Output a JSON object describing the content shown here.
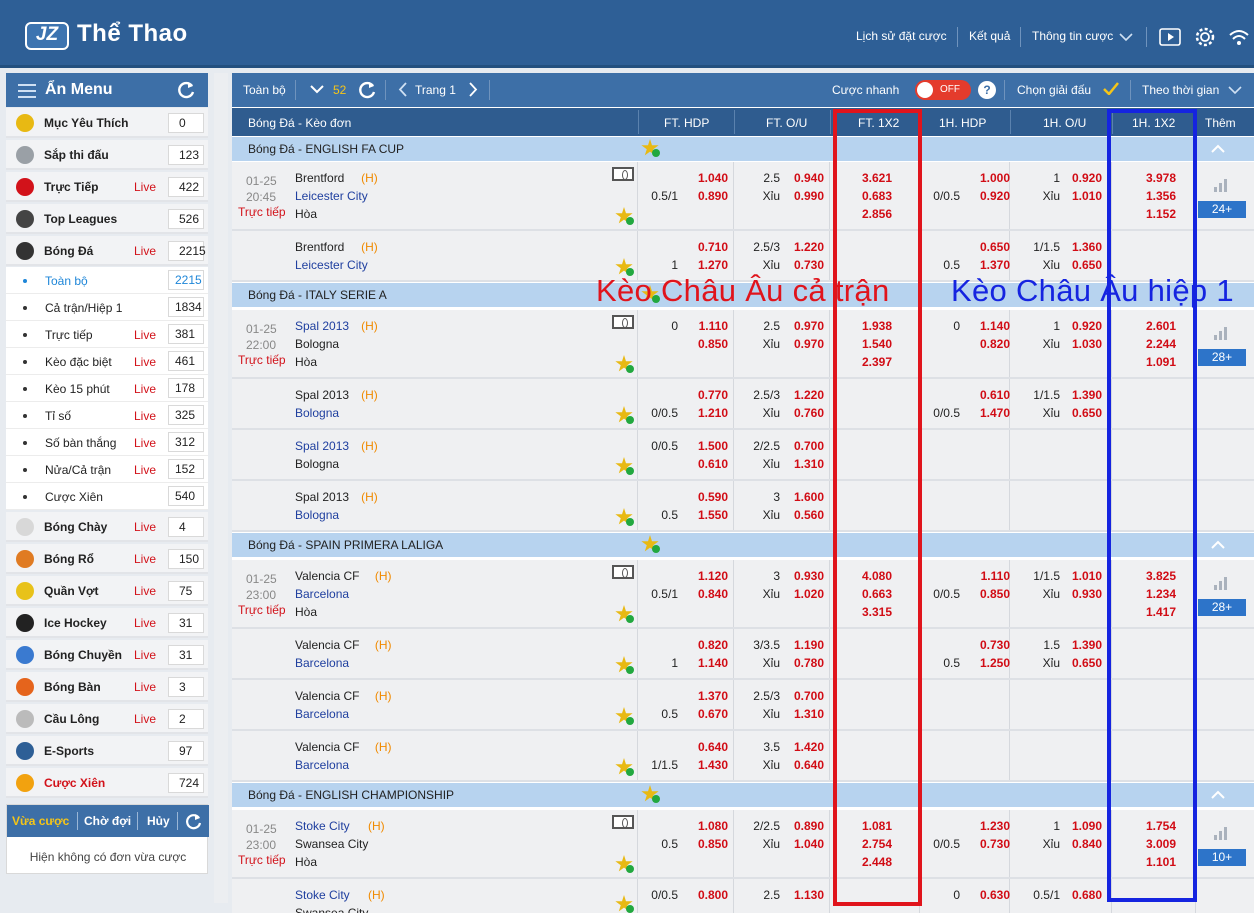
{
  "header": {
    "logo_mark": "JZ",
    "title": "Thể Thao",
    "nav": [
      "Lịch sử đặt cược",
      "Kết quả",
      "Thông tin cược"
    ]
  },
  "sidebar": {
    "title": "Ẩn Menu",
    "items": [
      {
        "label": "Mục Yêu Thích",
        "live": "",
        "count": "0",
        "icon": "star-icon",
        "color": "#e8b913"
      },
      {
        "label": "Sắp thi đấu",
        "live": "",
        "count": "123",
        "icon": "stopwatch-icon",
        "color": "#9aa0a6"
      },
      {
        "label": "Trực Tiếp",
        "live": "Live",
        "count": "422",
        "icon": "live-play-icon",
        "color": "#d2121a"
      },
      {
        "label": "Top Leagues",
        "live": "",
        "count": "526",
        "icon": "soccer-ball-icon",
        "color": "#444"
      },
      {
        "label": "Bóng Đá",
        "live": "Live",
        "count": "2215",
        "icon": "soccer-ball-icon",
        "color": "#333"
      }
    ],
    "subitems": [
      {
        "label": "Toàn bộ",
        "live": "",
        "count": "2215",
        "active": true
      },
      {
        "label": "Cả trận/Hiệp 1",
        "live": "",
        "count": "1834"
      },
      {
        "label": "Trực tiếp",
        "live": "Live",
        "count": "381"
      },
      {
        "label": "Kèo đặc biệt",
        "live": "Live",
        "count": "461"
      },
      {
        "label": "Kèo 15 phút",
        "live": "Live",
        "count": "178"
      },
      {
        "label": "Tỉ số",
        "live": "Live",
        "count": "325"
      },
      {
        "label": "Số bàn thắng",
        "live": "Live",
        "count": "312"
      },
      {
        "label": "Nửa/Cả trận",
        "live": "Live",
        "count": "152"
      },
      {
        "label": "Cược Xiên",
        "live": "",
        "count": "540"
      }
    ],
    "items2": [
      {
        "label": "Bóng Chày",
        "live": "Live",
        "count": "4",
        "icon": "baseball-icon",
        "color": "#d8d8d8"
      },
      {
        "label": "Bóng Rổ",
        "live": "Live",
        "count": "150",
        "icon": "basketball-icon",
        "color": "#e07b22"
      },
      {
        "label": "Quần Vợt",
        "live": "Live",
        "count": "75",
        "icon": "tennis-ball-icon",
        "color": "#e8c21a"
      },
      {
        "label": "Ice Hockey",
        "live": "Live",
        "count": "31",
        "icon": "hockey-puck-icon",
        "color": "#222"
      },
      {
        "label": "Bóng Chuyền",
        "live": "Live",
        "count": "31",
        "icon": "volleyball-icon",
        "color": "#3a7ad0"
      },
      {
        "label": "Bóng Bàn",
        "live": "Live",
        "count": "3",
        "icon": "ping-pong-icon",
        "color": "#e5641c"
      },
      {
        "label": "Cầu Lông",
        "live": "Live",
        "count": "2",
        "icon": "shuttlecock-icon",
        "color": "#bbb"
      },
      {
        "label": "E-Sports",
        "live": "",
        "count": "97",
        "icon": "gamepad-icon",
        "color": "#2e5f96"
      },
      {
        "label": "Cược Xiên",
        "live": "",
        "count": "724",
        "icon": "parlay-sun-icon",
        "color": "#f2a20f",
        "red": true
      }
    ],
    "bet_tabs": [
      "Vừa cược",
      "Chờ đợi",
      "Hủy"
    ],
    "bet_empty": "Hiện không có đơn vừa cược"
  },
  "toolbar": {
    "all": "Toàn bộ",
    "count": "52",
    "page": "Trang 1",
    "quick_bet": "Cược nhanh",
    "toggle": "OFF",
    "help": "?",
    "choose_league": "Chọn giải đấu",
    "sort": "Theo thời gian"
  },
  "columns": [
    "Bóng Đá - Kèo đơn",
    "FT. HDP",
    "FT. O/U",
    "FT. 1X2",
    "1H. HDP",
    "1H. O/U",
    "1H. 1X2",
    "Thêm"
  ],
  "leagues": {
    "l1": "Bóng Đá - ENGLISH FA CUP",
    "l2": "Bóng Đá - ITALY SERIE A",
    "l3": "Bóng Đá - SPAIN PRIMERA LALIGA",
    "l4": "Bóng Đá - ENGLISH CHAMPIONSHIP"
  },
  "common": {
    "home": "(H)",
    "draw": "Hòa",
    "live": "Trực tiếp",
    "under": "Xỉu"
  },
  "matches": {
    "m1": {
      "date": "01-25",
      "time": "20:45",
      "home": "Brentford",
      "away": "Leicester City",
      "more": "24+",
      "r1": {
        "hdp_line": "0.5/1",
        "hdp1": "1.040",
        "hdp2": "0.890",
        "ou_line": "2.5",
        "ou1": "0.940",
        "ou2": "0.990",
        "x1": "3.621",
        "x2": "0.683",
        "x3": "2.856",
        "hhdp_line": "0/0.5",
        "hhdp1": "1.000",
        "hhdp2": "0.920",
        "hou_line": "1",
        "hou1": "0.920",
        "hou2": "1.010",
        "hx1": "3.978",
        "hx2": "1.356",
        "hx3": "1.152"
      },
      "r2": {
        "hdp_line": "1",
        "hdp1": "0.710",
        "hdp2": "1.270",
        "ou_line": "2.5/3",
        "ou1": "1.220",
        "ou2": "0.730",
        "hhdp_line": "0.5",
        "hhdp1": "0.650",
        "hhdp2": "1.370",
        "hou_line": "1/1.5",
        "hou1": "1.360",
        "hou2": "0.650"
      }
    },
    "m2": {
      "date": "01-25",
      "time": "22:00",
      "home": "Spal 2013",
      "away": "Bologna",
      "more": "28+",
      "r1": {
        "hdp_line": "0",
        "hdp1": "1.110",
        "hdp2": "0.850",
        "ou_line": "2.5",
        "ou1": "0.970",
        "ou2": "0.970",
        "x1": "1.938",
        "x2": "1.540",
        "x3": "2.397",
        "hhdp_line": "0",
        "hhdp1": "1.140",
        "hhdp2": "0.820",
        "hou_line": "1",
        "hou1": "0.920",
        "hou2": "1.030",
        "hx1": "2.601",
        "hx2": "2.244",
        "hx3": "1.091"
      },
      "r2": {
        "hdp_line": "0/0.5",
        "hdp1": "0.770",
        "hdp2": "1.210",
        "ou_line": "2.5/3",
        "ou1": "1.220",
        "ou2": "0.760",
        "hhdp_line": "0/0.5",
        "hhdp1": "0.610",
        "hhdp2": "1.470",
        "hou_line": "1/1.5",
        "hou1": "1.390",
        "hou2": "0.650"
      },
      "r3": {
        "hdp_line": "0/0.5",
        "hdp1": "1.500",
        "hdp2": "0.610",
        "ou_line": "2/2.5",
        "ou1": "0.700",
        "ou2": "1.310"
      },
      "r4": {
        "hdp_line": "0.5",
        "hdp1": "0.590",
        "hdp2": "1.550",
        "ou_line": "3",
        "ou1": "1.600",
        "ou2": "0.560"
      }
    },
    "m3": {
      "date": "01-25",
      "time": "23:00",
      "home": "Valencia CF",
      "away": "Barcelona",
      "more": "28+",
      "r1": {
        "hdp_line": "0.5/1",
        "hdp1": "1.120",
        "hdp2": "0.840",
        "ou_line": "3",
        "ou1": "0.930",
        "ou2": "1.020",
        "x1": "4.080",
        "x2": "0.663",
        "x3": "3.315",
        "hhdp_line": "0/0.5",
        "hhdp1": "1.110",
        "hhdp2": "0.850",
        "hou_line": "1/1.5",
        "hou1": "1.010",
        "hou2": "0.930",
        "hx1": "3.825",
        "hx2": "1.234",
        "hx3": "1.417"
      },
      "r2": {
        "hdp_line": "1",
        "hdp1": "0.820",
        "hdp2": "1.140",
        "ou_line": "3/3.5",
        "ou1": "1.190",
        "ou2": "0.780",
        "hhdp_line": "0.5",
        "hhdp1": "0.730",
        "hhdp2": "1.250",
        "hou_line": "1.5",
        "hou1": "1.390",
        "hou2": "0.650"
      },
      "r3": {
        "hdp_line": "0.5",
        "hdp1": "1.370",
        "hdp2": "0.670",
        "ou_line": "2.5/3",
        "ou1": "0.700",
        "ou2": "1.310"
      },
      "r4": {
        "hdp_line": "1/1.5",
        "hdp1": "0.640",
        "hdp2": "1.430",
        "ou_line": "3.5",
        "ou1": "1.420",
        "ou2": "0.640"
      }
    },
    "m4": {
      "date": "01-25",
      "time": "23:00",
      "home": "Stoke City",
      "away": "Swansea City",
      "more": "10+",
      "r1": {
        "hdp_line": "0.5",
        "hdp1": "1.080",
        "hdp2": "0.850",
        "ou_line": "2/2.5",
        "ou1": "0.890",
        "ou2": "1.040",
        "x1": "1.081",
        "x2": "2.754",
        "x3": "2.448",
        "hhdp_line": "0/0.5",
        "hhdp1": "1.230",
        "hhdp2": "0.730",
        "hou_line": "1",
        "hou1": "1.090",
        "hou2": "0.840",
        "hx1": "1.754",
        "hx2": "3.009",
        "hx3": "1.101"
      },
      "r2": {
        "hdp_line": "0/0.5",
        "hdp1": "0.800",
        "ou_line": "2.5",
        "ou1": "1.130",
        "hhdp_line": "0",
        "hhdp1": "0.630",
        "hou_line": "0.5/1",
        "hou1": "0.680"
      }
    }
  },
  "annotations": {
    "red_label": "Kèo Châu Âu cả trận",
    "blue_label": "Kèo Châu Âu hiệp 1",
    "red": "#e0141c",
    "blue": "#1524e0"
  },
  "colors": {
    "header": "#2e5f96",
    "league_bar": "#b7d3ef",
    "odds": "#d10c15",
    "team_fav": "#1f3f9f",
    "home_tag": "#f08a00"
  }
}
